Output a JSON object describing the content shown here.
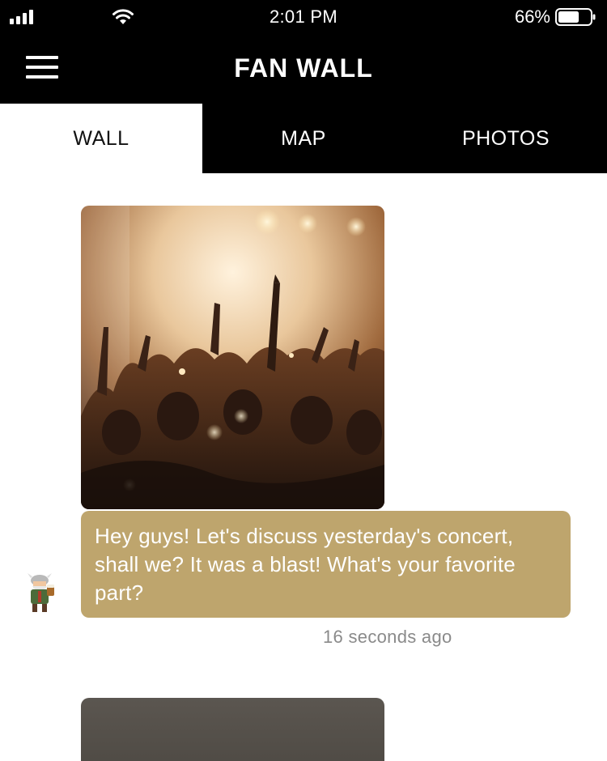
{
  "status_bar": {
    "time": "2:01 PM",
    "battery_percent": "66%",
    "battery_level": 0.66
  },
  "header": {
    "title": "FAN WALL"
  },
  "tabs": [
    {
      "label": "WALL",
      "active": true
    },
    {
      "label": "MAP",
      "active": false
    },
    {
      "label": "PHOTOS",
      "active": false
    }
  ],
  "posts": [
    {
      "image": "concert-crowd-photo",
      "message": "Hey guys! Let's discuss yesterday's concert, shall we? It was a blast! What's your favorite part?",
      "timestamp": "16 seconds ago",
      "avatar": "viking-avatar-icon"
    }
  ],
  "colors": {
    "bubble": "#bea56d",
    "header": "#000000",
    "timestamp": "#8a8a8a"
  }
}
